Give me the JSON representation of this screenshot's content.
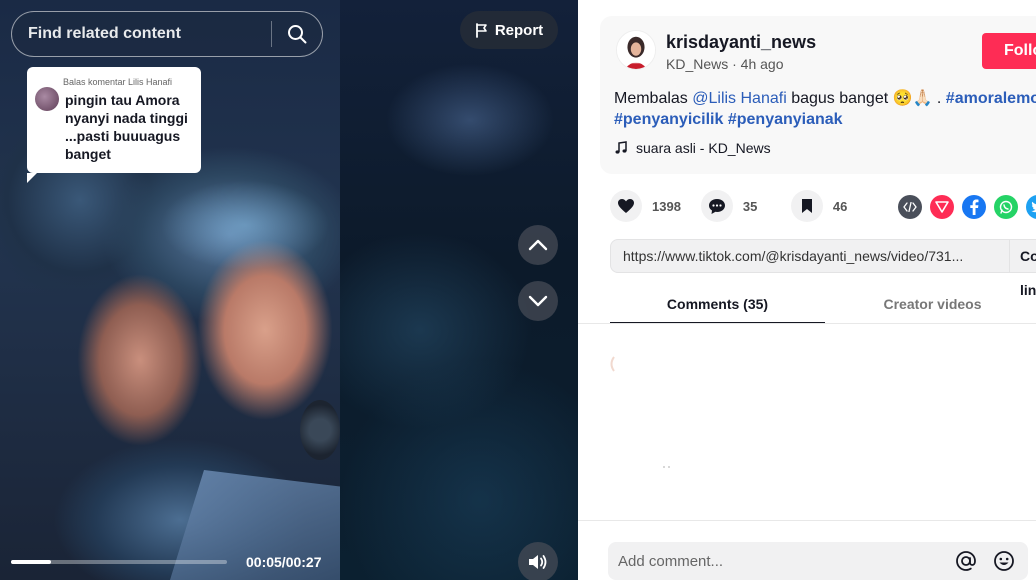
{
  "video": {
    "search_placeholder": "Find related content",
    "report_label": "Report",
    "reply_bubble": {
      "meta": "Balas komentar Lilis Hanafi",
      "text": "pingin tau Amora nyanyi nada tinggi ...pasti buuuagus banget"
    },
    "progress_fraction": 0.185,
    "time_readout": "00:05/00:27"
  },
  "post": {
    "author_name": "krisdayanti_news",
    "author_sub": "KD_News · 4h ago",
    "follow_label": "Follow",
    "description": {
      "prefix": "Membalas ",
      "mention": "@Lilis Hanafi",
      "middle": " bagus banget 🥺🙏🏻 . ",
      "tag1": "#amoralemos",
      "tag2": "#penyanyicilik",
      "tag3": "#penyanyianak"
    },
    "music": "suara asli - KD_News"
  },
  "actions": {
    "likes": "1398",
    "comments": "35",
    "saves": "46"
  },
  "share_icons": [
    "embed-icon",
    "send-icon",
    "facebook-icon",
    "whatsapp-icon",
    "twitter-icon"
  ],
  "colors": {
    "accent": "#fe2c55",
    "link": "#2b5db9",
    "facebook": "#1877f2",
    "whatsapp": "#25d366",
    "twitter": "#1da1f2"
  },
  "link_box": {
    "url": "https://www.tiktok.com/@krisdayanti_news/video/731...",
    "copy_label": "Copy link"
  },
  "tabs": [
    {
      "label": "Comments (35)",
      "active": true
    },
    {
      "label": "Creator videos",
      "active": false
    }
  ],
  "comment_input": {
    "placeholder": "Add comment..."
  }
}
